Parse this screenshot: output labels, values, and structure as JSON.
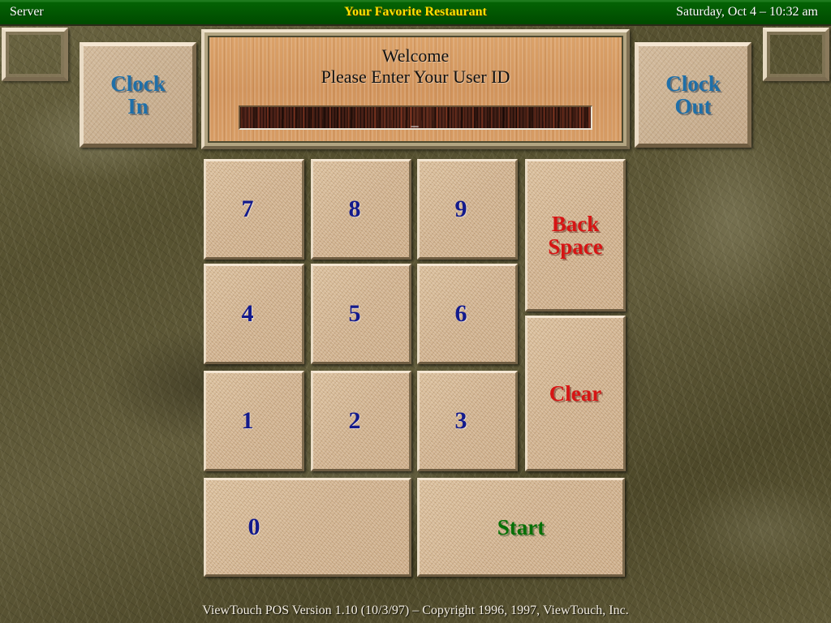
{
  "titlebar": {
    "role": "Server",
    "restaurant": "Your Favorite Restaurant",
    "datetime": "Saturday, Oct 4 – 10:32 am",
    "bg_color": "#004a00",
    "restaurant_color": "#ffe000",
    "text_color": "#ffffff"
  },
  "clock": {
    "in_label": "Clock\nIn",
    "in_line1": "Clock",
    "in_line2": "In",
    "out_line1": "Clock",
    "out_line2": "Out",
    "label_color": "#1f6fa8"
  },
  "welcome": {
    "line1": "Welcome",
    "line2": "Please Enter Your User ID",
    "input_value": "_",
    "input_placeholder": "",
    "panel_color": "#d79a64",
    "field_color": "#4a2117"
  },
  "keypad": {
    "rows": [
      [
        {
          "key": "7"
        },
        {
          "key": "8"
        },
        {
          "key": "9"
        }
      ],
      [
        {
          "key": "4"
        },
        {
          "key": "5"
        },
        {
          "key": "6"
        }
      ],
      [
        {
          "key": "1"
        },
        {
          "key": "2"
        },
        {
          "key": "3"
        }
      ]
    ],
    "zero": "0",
    "digit_color": "#131a8c"
  },
  "actions": {
    "backspace_line1": "Back",
    "backspace_line2": "Space",
    "clear": "Clear",
    "start": "Start",
    "red_color": "#d61414",
    "green_color": "#067006"
  },
  "footer": {
    "text": "ViewTouch POS Version 1.10 (10/3/97) – Copyright 1996, 1997, ViewTouch, Inc."
  }
}
